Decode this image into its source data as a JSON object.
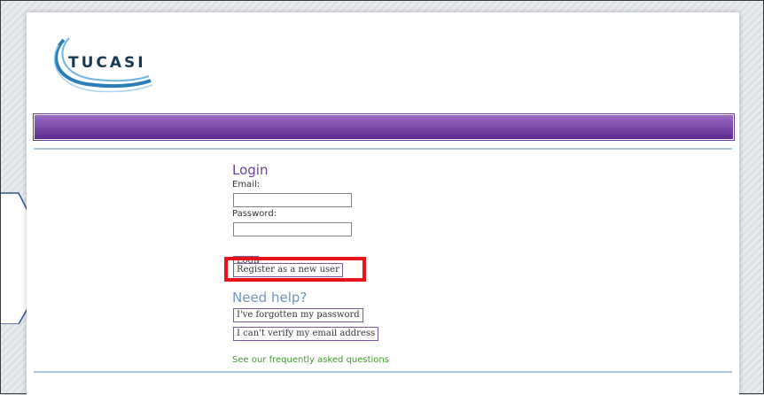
{
  "logo": {
    "brand": "TUCASI"
  },
  "login": {
    "heading": "Login",
    "email_label": "Email:",
    "email_value": "",
    "password_label": "Password:",
    "password_value": "",
    "login_button": "Login",
    "register_button": "Register as a new user"
  },
  "help": {
    "heading": "Need help?",
    "forgot_button": "I've forgotten my password",
    "verify_button": "I can't verify my email address",
    "faq_link": "See our frequently asked questions"
  },
  "colors": {
    "banner": "#6a3a9a",
    "heading": "#6a3f9a",
    "help_heading": "#6f93c2",
    "link": "#3f9a2a",
    "highlight": "#e8121b"
  }
}
